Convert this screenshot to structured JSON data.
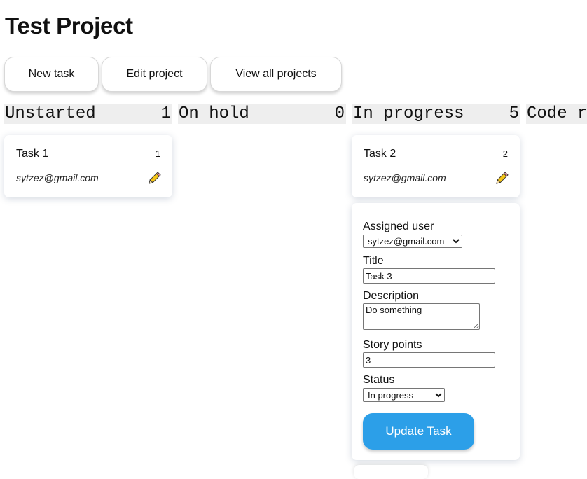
{
  "page": {
    "title": "Test Project"
  },
  "toolbar": {
    "new_task_label": "New task",
    "edit_project_label": "Edit project",
    "view_all_label": "View all projects"
  },
  "columns": [
    {
      "name": "Unstarted",
      "count": "1"
    },
    {
      "name": "On hold",
      "count": "0"
    },
    {
      "name": "In progress",
      "count": "5"
    },
    {
      "name": "Code r",
      "count": ""
    }
  ],
  "tasks": [
    {
      "title": "Task 1",
      "points": "1",
      "user": "sytzez@gmail.com",
      "edit_icon": "pencil-icon"
    },
    {
      "title": "Task 2",
      "points": "2",
      "user": "sytzez@gmail.com",
      "edit_icon": "pencil-icon"
    }
  ],
  "edit_form": {
    "assigned_user_label": "Assigned user",
    "assigned_user_value": "sytzez@gmail.com",
    "title_label": "Title",
    "title_value": "Task 3",
    "description_label": "Description",
    "description_value": "Do something",
    "story_points_label": "Story points",
    "story_points_value": "3",
    "status_label": "Status",
    "status_value": "In progress",
    "submit_label": "Update Task"
  },
  "colors": {
    "accent": "#2c9fe8",
    "column_header_bg": "#eeeeee",
    "pencil_body": "#f5c518"
  }
}
